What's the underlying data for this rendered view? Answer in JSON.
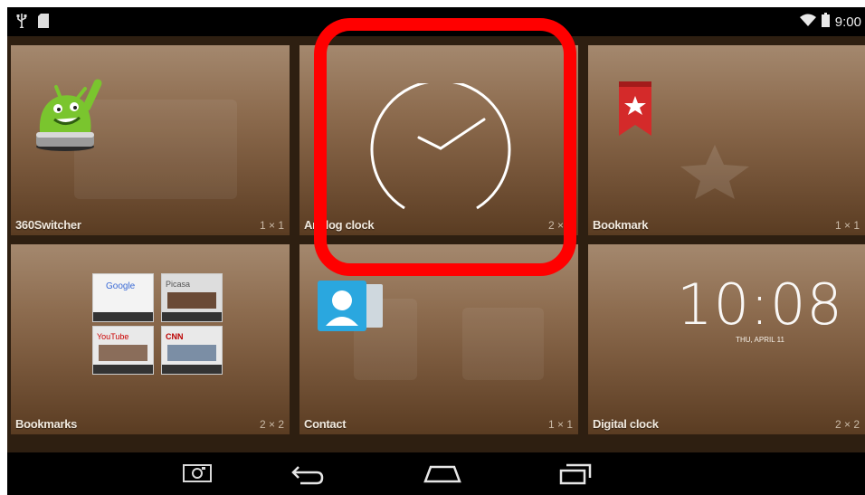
{
  "status_bar": {
    "time": "9:00",
    "icons": [
      "usb-icon",
      "sd-card-icon",
      "wifi-icon",
      "battery-icon"
    ]
  },
  "widgets": [
    {
      "name": "360Switcher",
      "size": "1 × 1"
    },
    {
      "name": "Analog clock",
      "size": "2 × 2"
    },
    {
      "name": "Bookmark",
      "size": "1 × 1"
    },
    {
      "name": "Bookmarks",
      "size": "2 × 2"
    },
    {
      "name": "Contact",
      "size": "1 × 1"
    },
    {
      "name": "Digital clock",
      "size": "2 × 2"
    }
  ],
  "digital_clock_preview": {
    "time": "10:08",
    "date": "THU, APRIL 11"
  },
  "bookmarks_preview": [
    "Google",
    "Picasa",
    "YouTube",
    "CNN"
  ],
  "nav_bar": {
    "buttons": [
      "screenshot",
      "back",
      "home",
      "recent-apps"
    ]
  },
  "colors": {
    "highlight": "#ff0000",
    "tile_top": "#a4886e",
    "tile_bottom": "#5a3c22",
    "bookmark_ribbon": "#d42a2a",
    "android_green": "#7ac52e",
    "contact_blue": "#2aa7df"
  }
}
